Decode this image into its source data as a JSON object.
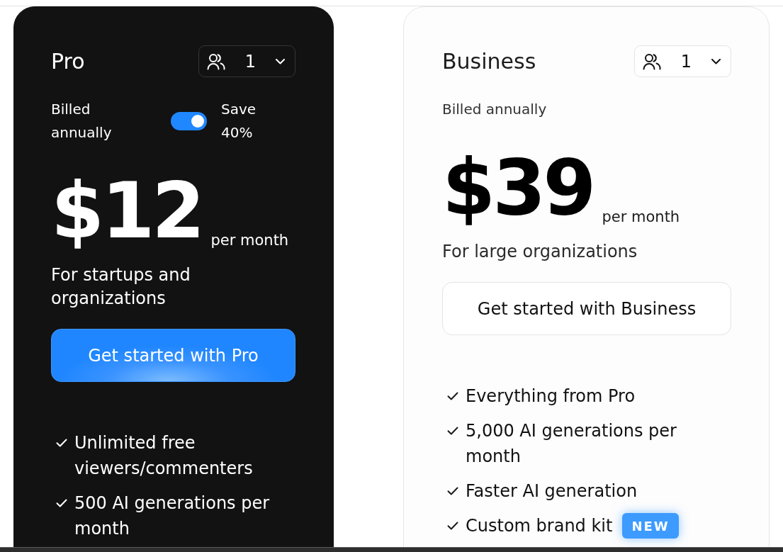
{
  "plans": [
    {
      "kind": "highlighted",
      "name": "Pro",
      "seats": "1",
      "billing": {
        "label": "Billed annually",
        "toggle": {
          "on": true
        },
        "savings": "Save 40%"
      },
      "price": "$12",
      "period": "per month",
      "audience": "For startups and organizations",
      "cta": "Get started with Pro",
      "features": [
        {
          "text": "Unlimited free viewers/commenters"
        },
        {
          "text": "500 AI generations per month"
        }
      ]
    },
    {
      "kind": "standard",
      "name": "Business",
      "seats": "1",
      "billing": {
        "label": "Billed annually"
      },
      "price": "$39",
      "period": "per month",
      "audience": "For large organizations",
      "cta": "Get started with Business",
      "features": [
        {
          "text": "Everything from Pro"
        },
        {
          "text": "5,000 AI generations per month"
        },
        {
          "text": "Faster AI generation"
        },
        {
          "text": "Custom brand kit",
          "badge": "NEW"
        }
      ]
    }
  ]
}
